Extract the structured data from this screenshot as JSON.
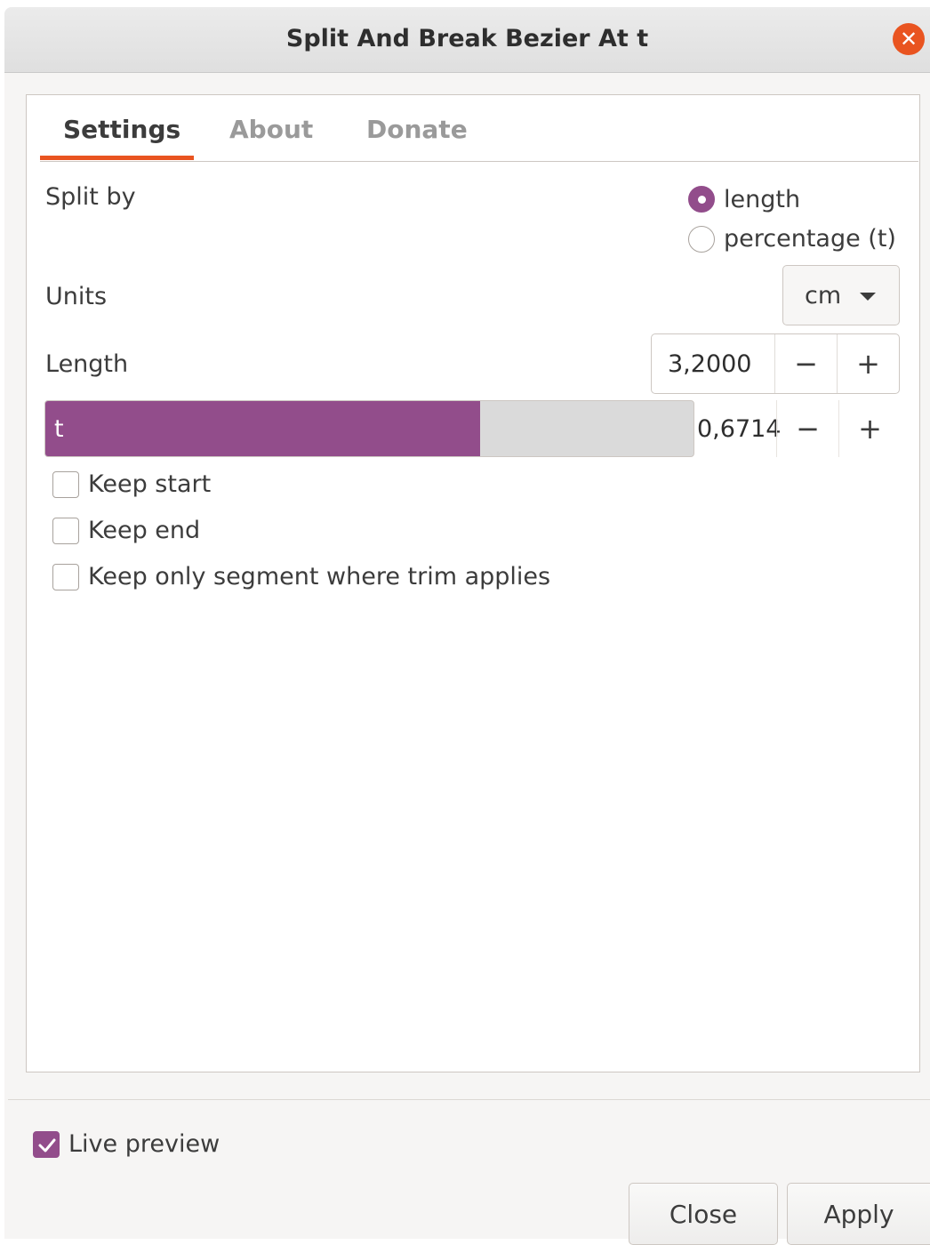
{
  "window": {
    "title": "Split And Break Bezier At t"
  },
  "tabs": [
    {
      "label": "Settings",
      "active": true
    },
    {
      "label": "About",
      "active": false
    },
    {
      "label": "Donate",
      "active": false
    }
  ],
  "split_by": {
    "label": "Split by",
    "options": [
      {
        "label": "length",
        "selected": true
      },
      {
        "label": "percentage (t)",
        "selected": false
      }
    ]
  },
  "units": {
    "label": "Units",
    "value": "cm"
  },
  "length": {
    "label": "Length",
    "value": "3,2000"
  },
  "t_scale": {
    "label": "t",
    "value": "0,6714",
    "fraction": 0.6714
  },
  "checkboxes": [
    {
      "label": "Keep start",
      "checked": false
    },
    {
      "label": "Keep end",
      "checked": false
    },
    {
      "label": "Keep only segment where trim applies",
      "checked": false
    }
  ],
  "live_preview": {
    "label": "Live preview",
    "checked": true
  },
  "buttons": {
    "close": "Close",
    "apply": "Apply"
  },
  "colors": {
    "accent": "#924d8b",
    "tab_underline": "#e95420",
    "close_button": "#e95420"
  }
}
